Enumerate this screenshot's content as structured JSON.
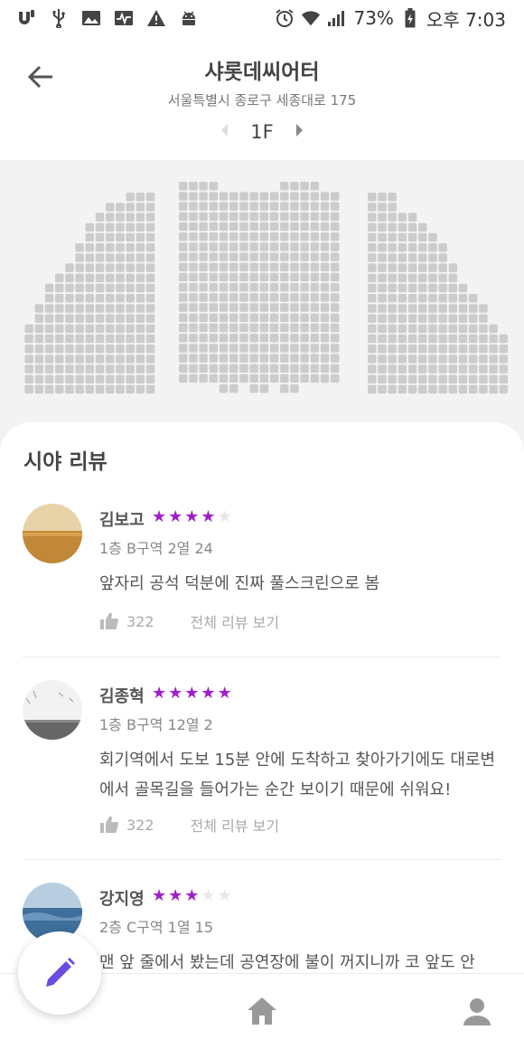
{
  "status_bar": {
    "left_icons": [
      "u-plus-icon",
      "usb-icon",
      "image-icon",
      "pulse-icon",
      "warning-icon",
      "android-icon"
    ],
    "battery": "73%",
    "time": "오후 7:03"
  },
  "header": {
    "title": "샤롯데씨어터",
    "address": "서울특별시 종로구 세종대로 175",
    "floor": "1F"
  },
  "seatmap": {
    "seat_color": "#cccccc"
  },
  "reviews": {
    "title": "시야 리뷰",
    "star_color": "#a020c8",
    "items": [
      {
        "name": "김보고",
        "rating": 4,
        "max_rating": 5,
        "seat": "1층 B구역 2열 24",
        "text": "앞자리 공석 덕분에 진짜 풀스크린으로 봄",
        "likes": "322",
        "all_reviews": "전체 리뷰 보기"
      },
      {
        "name": "김종혁",
        "rating": 5,
        "max_rating": 5,
        "seat": "1층 B구역 12열 2",
        "text": "회기역에서 도보 15분 안에 도착하고 찾아가기에도 대로변에서 골목길을 들어가는 순간 보이기 때문에 쉬워요!",
        "likes": "322",
        "all_reviews": "전체 리뷰 보기"
      },
      {
        "name": "강지영",
        "rating": 3,
        "max_rating": 5,
        "seat": "2층 C구역 1열 15",
        "text": "맨 앞 줄에서 봤는데 공연장에 불이 꺼지니까 코 앞도 안"
      }
    ]
  },
  "bottom_nav": {
    "items": [
      "home-icon",
      "profile-icon"
    ]
  },
  "fab": {
    "icon": "pencil-icon",
    "color": "#6a4ce0"
  }
}
